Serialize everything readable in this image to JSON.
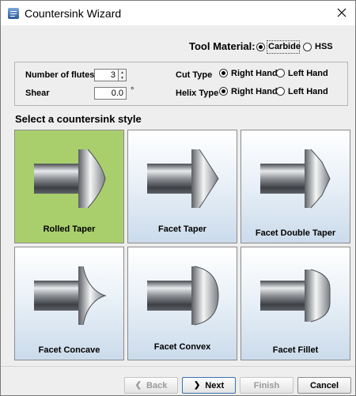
{
  "window": {
    "title": "Countersink Wizard"
  },
  "tool_material": {
    "label": "Tool Material:",
    "options": [
      {
        "label": "Carbide",
        "selected": true
      },
      {
        "label": "HSS",
        "selected": false
      }
    ]
  },
  "params": {
    "flutes_label": "Number of flutes",
    "flutes_value": "3",
    "shear_label": "Shear",
    "shear_value": "0.0",
    "shear_unit": "°",
    "cut_type_label": "Cut Type",
    "cut_type_options": [
      {
        "label": "Right Hand",
        "selected": true
      },
      {
        "label": "Left Hand",
        "selected": false
      }
    ],
    "helix_type_label": "Helix Type",
    "helix_type_options": [
      {
        "label": "Right Hand",
        "selected": true
      },
      {
        "label": "Left Hand",
        "selected": false
      }
    ]
  },
  "styles": {
    "heading": "Select a countersink style",
    "items": [
      {
        "label": "Rolled Taper",
        "selected": true
      },
      {
        "label": "Facet Taper",
        "selected": false
      },
      {
        "label": "Facet Double Taper",
        "selected": false
      },
      {
        "label": "Facet Concave",
        "selected": false
      },
      {
        "label": "Facet Convex",
        "selected": false
      },
      {
        "label": "Facet Fillet",
        "selected": false
      }
    ]
  },
  "buttons": {
    "back": "Back",
    "next": "Next",
    "finish": "Finish",
    "cancel": "Cancel"
  },
  "colors": {
    "selected_card": "#a9cf6c",
    "card_gradient_bottom": "#cbdbeb"
  }
}
